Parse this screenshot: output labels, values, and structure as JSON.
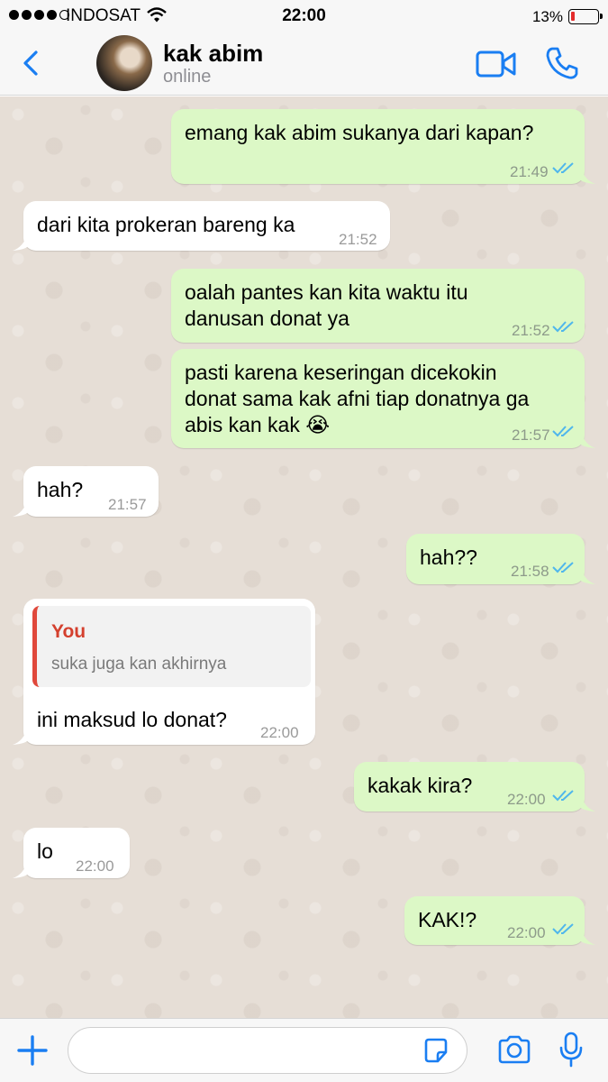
{
  "status_bar": {
    "carrier": "INDOSAT",
    "time": "22:00",
    "battery_percent": "13%",
    "battery_level": 0.13,
    "battery_color": "#e32b2b"
  },
  "header": {
    "contact_name": "kak abim",
    "contact_status": "online",
    "accent_color": "#1a7ef2"
  },
  "messages": [
    {
      "dir": "out",
      "text": "emang kak abim sukanya dari kapan?",
      "time": "21:49",
      "read": true
    },
    {
      "dir": "in",
      "text": "dari kita prokeran bareng ka",
      "time": "21:52"
    },
    {
      "dir": "out",
      "text": "oalah pantes kan kita waktu itu\ndanusan donat ya",
      "time": "21:52",
      "read": true
    },
    {
      "dir": "out",
      "text": "pasti karena keseringan dicekokin\ndonat sama kak afni tiap donatnya ga\nabis kan kak 😭",
      "time": "21:57",
      "read": true
    },
    {
      "dir": "in",
      "text": "hah?",
      "time": "21:57"
    },
    {
      "dir": "out",
      "text": "hah??",
      "time": "21:58",
      "read": true
    },
    {
      "dir": "in",
      "text": "ini maksud lo donat?",
      "time": "22:00",
      "quote": {
        "author": "You",
        "text": "suka juga kan akhirnya"
      }
    },
    {
      "dir": "out",
      "text": "kakak kira?",
      "time": "22:00",
      "read": true
    },
    {
      "dir": "in",
      "text": "lo",
      "time": "22:00"
    },
    {
      "dir": "out",
      "text": "KAK!?",
      "time": "22:00",
      "read": true
    }
  ],
  "colors": {
    "outgoing_bubble": "#dcf8c6",
    "incoming_bubble": "#ffffff",
    "read_ticks": "#4fb6ec",
    "chat_background": "#e6ded6",
    "quote_accent": "#d4402e"
  },
  "input": {
    "placeholder": "",
    "icons": [
      "plus-icon",
      "sticker-icon",
      "camera-icon",
      "microphone-icon"
    ]
  }
}
